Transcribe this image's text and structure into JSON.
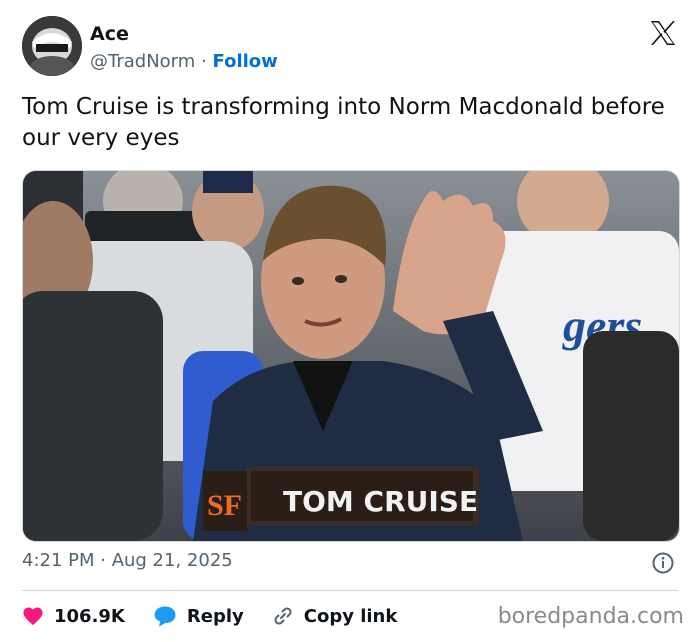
{
  "author": {
    "display_name": "Ace",
    "handle": "@TradNorm",
    "separator": "·",
    "follow_label": "Follow"
  },
  "tweet": {
    "text": "Tom Cruise is transforming into Norm Macdonald before our very eyes",
    "timestamp": "4:21 PM · Aug 21, 2025"
  },
  "media": {
    "nameplate_text": "TOM CRUISE",
    "jersey_text": "gers",
    "team_logo_letters": "SF"
  },
  "actions": {
    "likes_count": "106.9K",
    "reply_label": "Reply",
    "copy_link_label": "Copy link"
  },
  "watermark": "boredpanda.com",
  "colors": {
    "like": "#f91880",
    "reply": "#1d9bf0",
    "follow": "#006fd6",
    "muted": "#536471"
  }
}
